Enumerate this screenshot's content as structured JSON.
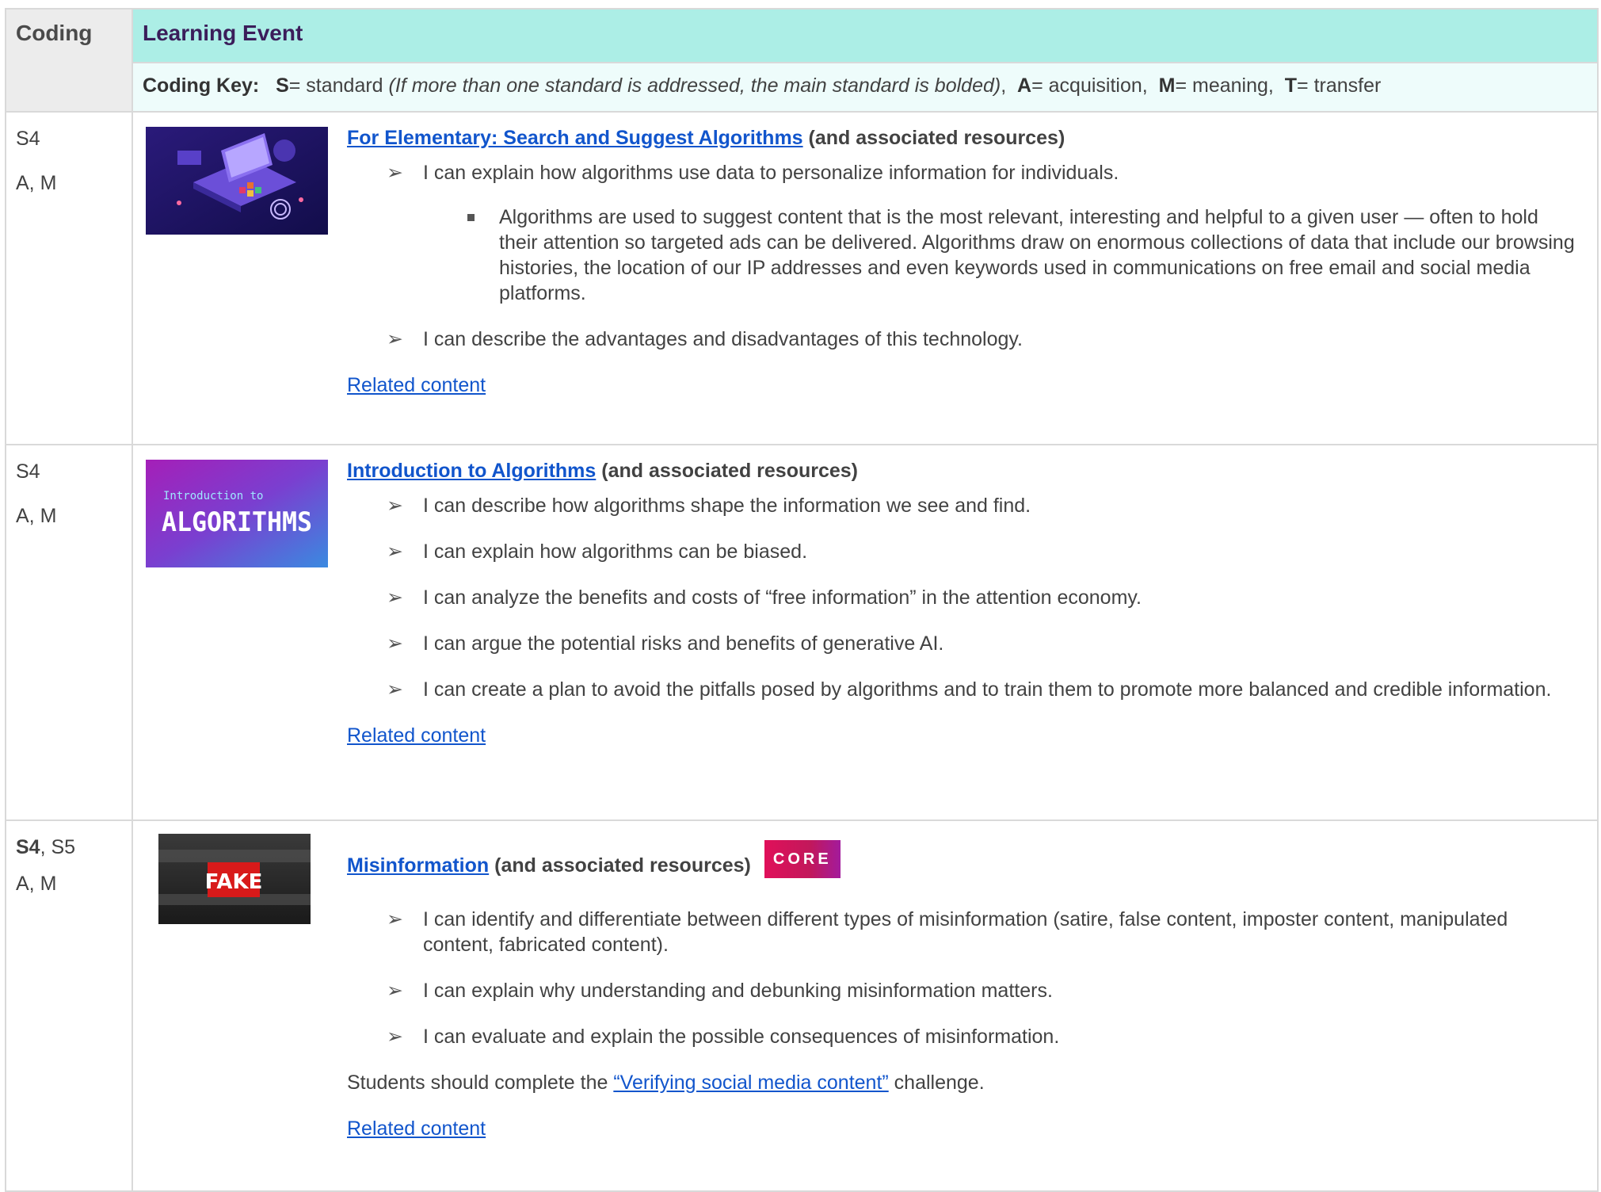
{
  "header": {
    "coding": "Coding",
    "learning_event": "Learning Event"
  },
  "key": {
    "label": "Coding Key:",
    "s_letter": "S",
    "s_text": "= standard ",
    "s_note": "(If more than one standard is addressed, the main standard is bolded)",
    "a_letter": "A",
    "a_text": "= acquisition,",
    "m_letter": "M",
    "m_text": "= meaning,",
    "t_letter": "T",
    "t_text": "= transfer"
  },
  "rows": [
    {
      "code_standards": "S4",
      "code_levels": "A, M",
      "title_link": "For Elementary: Search and Suggest Algorithms",
      "title_suffix": "(and associated resources)",
      "bullets": [
        "I can explain how algorithms use data to personalize information for individuals.",
        "I can describe the advantages and disadvantages of this technology."
      ],
      "sub_bullet": "Algorithms are used to suggest content that is the most relevant, interesting and helpful to a given user — often to hold their attention so targeted ads can be delivered. Algorithms draw on enormous collections of data that include our browsing histories, the location of our IP addresses and even keywords used in communications on free email and social media platforms.",
      "related": "Related content"
    },
    {
      "code_standards": "S4",
      "code_levels": "A, M",
      "title_link": "Introduction to Algorithms",
      "title_suffix": "(and associated resources)",
      "thumb_small": "Introduction to",
      "thumb_big": "ALGORITHMS",
      "bullets": [
        "I can describe how algorithms shape the information we see and find.",
        "I can explain how algorithms can be biased.",
        "I can analyze the benefits and costs of “free information” in the attention economy.",
        "I can argue the potential risks and benefits of generative AI.",
        "I can create a plan to avoid the pitfalls posed by algorithms and to train them to promote more balanced and credible information."
      ],
      "related": "Related content"
    },
    {
      "code_standards_bold": "S4",
      "code_standards_rest": ", S5",
      "code_levels": "A, M",
      "title_link": "Misinformation",
      "title_suffix": "(and associated resources)",
      "badge": "CORE",
      "thumb_text": "FAKE",
      "bullets": [
        "I can identify and differentiate between different types of misinformation (satire, false content, imposter content, manipulated content, fabricated content).",
        "I can explain why understanding and debunking misinformation matters.",
        "I can evaluate and explain the possible consequences of misinformation."
      ],
      "note_before": "Students should complete the ",
      "note_link": "“Verifying social media content”",
      "note_after": " challenge.",
      "related": "Related content"
    }
  ],
  "arrow_glyph": "➢"
}
